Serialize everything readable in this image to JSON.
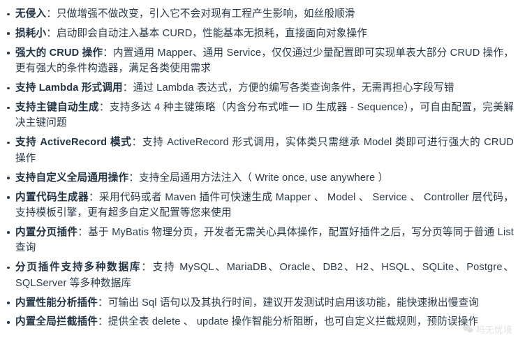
{
  "page": {
    "background_color": "#ffffff",
    "text_color": "#2b3a4a",
    "bullet_color": "#2b3a4a"
  },
  "features": [
    {
      "term": "无侵入",
      "separator": "：",
      "desc": "只做增强不做改变，引入它不会对现有工程产生影响，如丝般顺滑"
    },
    {
      "term": "损耗小",
      "separator": "：",
      "desc": "启动即会自动注入基本 CURD，性能基本无损耗，直接面向对象操作"
    },
    {
      "term": "强大的 CRUD 操作",
      "separator": "：",
      "desc": "内置通用 Mapper、通用 Service，仅仅通过少量配置即可实现单表大部分 CRUD 操作，更有强大的条件构造器，满足各类使用需求"
    },
    {
      "term": "支持 Lambda 形式调用",
      "separator": "：",
      "desc": "通过 Lambda 表达式，方便的编写各类查询条件，无需再担心字段写错"
    },
    {
      "term": "支持主键自动生成",
      "separator": "：",
      "desc": "支持多达 4 种主键策略（内含分布式唯一 ID 生成器 - Sequence），可自由配置，完美解决主键问题"
    },
    {
      "term": "支持 ActiveRecord 模式",
      "separator": "：",
      "desc": "支持 ActiveRecord 形式调用，实体类只需继承 Model 类即可进行强大的 CRUD 操作"
    },
    {
      "term": "支持自定义全局通用操作",
      "separator": "：",
      "desc": "支持全局通用方法注入（ Write once, use anywhere ）"
    },
    {
      "term": "内置代码生成器",
      "separator": "：",
      "desc": "采用代码或者 Maven 插件可快速生成 Mapper 、 Model 、 Service 、 Controller 层代码，支持模板引擎，更有超多自定义配置等您来使用"
    },
    {
      "term": "内置分页插件",
      "separator": "：",
      "desc": "基于 MyBatis 物理分页，开发者无需关心具体操作，配置好插件之后，写分页等同于普通 List 查询"
    },
    {
      "term": "分页插件支持多种数据库",
      "separator": "：",
      "desc": "支持 MySQL、MariaDB、Oracle、DB2、H2、HSQL、SQLite、Postgre、SQLServer 等多种数据库"
    },
    {
      "term": "内置性能分析插件",
      "separator": "：",
      "desc": "可输出 Sql 语句以及其执行时间，建议开发测试时启用该功能，能快速揪出慢查询"
    },
    {
      "term": "内置全局拦截插件",
      "separator": "：",
      "desc": "提供全表 delete 、 update 操作智能分析阻断，也可自定义拦截规则，预防误操作"
    }
  ],
  "watermark": {
    "icon": "wechat-icon",
    "text": "吗无忧境"
  }
}
